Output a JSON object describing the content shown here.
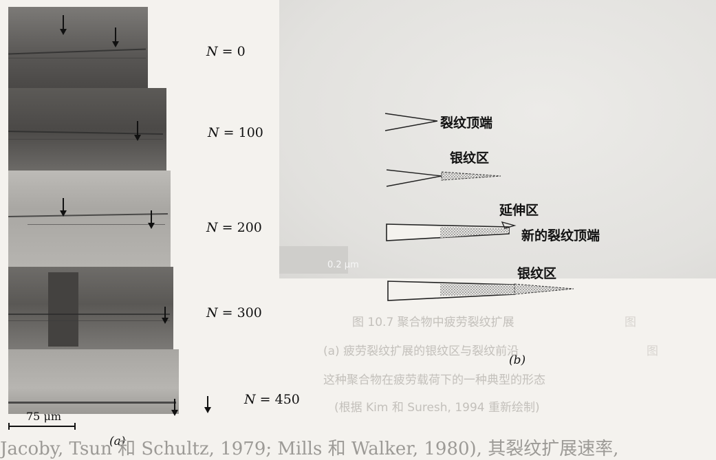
{
  "panel_a": {
    "labels": [
      "N = 0",
      "N = 100",
      "N = 200",
      "N = 300",
      "N = 450"
    ],
    "scale": "75 μm",
    "caption": "(a)"
  },
  "panel_b": {
    "labels": {
      "crack_tip": "裂纹顶端",
      "craze_1": "银纹区",
      "extension": "延伸区",
      "new_crack_tip": "新的裂纹顶端",
      "craze_2": "银纹区"
    },
    "scale": "0.2 μm",
    "caption": "(b)"
  },
  "background_text": {
    "caption_line1": "图 10.7  聚合物中疲劳裂纹扩展",
    "caption_line2": "(a) 疲劳裂纹扩展的银纹区与裂纹前沿",
    "caption_line3": "这种聚合物在疲劳载荷下的一种典型的形态",
    "caption_line4": "(根据 Kim 和 Suresh, 1994 重新绘制)",
    "bottom": "Jacoby, Tsun 和 Schultz, 1979; Mills 和 Walker, 1980), 其裂纹扩展速率,"
  }
}
